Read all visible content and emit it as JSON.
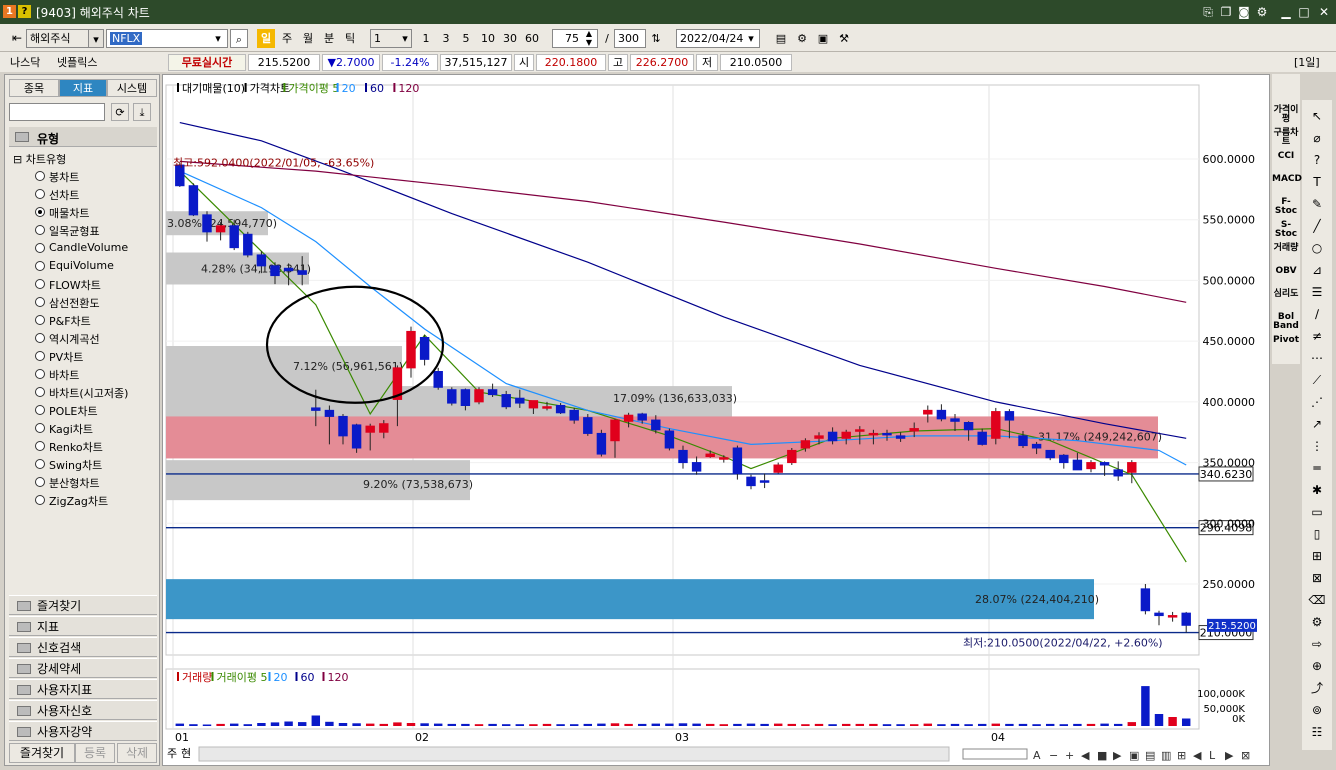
{
  "window": {
    "title": "[9403] 해외주식 차트",
    "badge1": "1",
    "badge2": "?"
  },
  "toolbar": {
    "market": "해외주식",
    "ticker": "NFLX",
    "period_buttons": [
      "일",
      "주",
      "월",
      "분",
      "틱"
    ],
    "interval_value": "1",
    "interval_buttons": [
      "1",
      "3",
      "5",
      "10",
      "30",
      "60"
    ],
    "count_display": "75",
    "count_sep": "/",
    "count_total": "300",
    "date": "2022/04/24"
  },
  "info": {
    "exchange": "나스닥",
    "name": "넷플릭스",
    "realtime_label": "무료실시간",
    "price": "215.5200",
    "change": "▼2.7000",
    "change_pct": "-1.24%",
    "volume": "37,515,127",
    "open_label": "시",
    "open": "220.1800",
    "high_label": "고",
    "high": "226.2700",
    "low_label": "저",
    "low": "210.0500",
    "period_tag": "[1일]"
  },
  "leftpanel": {
    "tabs": [
      "종목",
      "지표",
      "시스템"
    ],
    "active_tab": "지표",
    "section_title": "유형",
    "tree_root": "차트유형",
    "chart_types": [
      "봉차트",
      "선차트",
      "매물차트",
      "일목균형표",
      "CandleVolume",
      "EquiVolume",
      "FLOW차트",
      "삼선전환도",
      "P&F차트",
      "역시계곡선",
      "PV차트",
      "바차트",
      "바차트(시고저종)",
      "POLE차트",
      "Kagi차트",
      "Renko차트",
      "Swing차트",
      "분산형차트",
      "ZigZag차트"
    ],
    "selected_type": "매물차트",
    "folders": [
      "즐겨찾기",
      "지표",
      "신호검색",
      "강세약세",
      "사용자지표",
      "사용자신호",
      "사용자강약"
    ],
    "bottom_buttons": [
      "즐겨찾기",
      "등록",
      "삭제"
    ]
  },
  "chart": {
    "legend": [
      "대기매물(10)",
      "가격차트",
      "가격이평 5",
      "20",
      "60",
      "120"
    ],
    "legend_colors": [
      "#000000",
      "#000000",
      "#3a8a00",
      "#1e90ff",
      "#00008b",
      "#800040"
    ],
    "y_ticks": [
      "600.0000",
      "550.0000",
      "500.0000",
      "450.0000",
      "400.0000",
      "350.0000",
      "300.0000",
      "250.0000"
    ],
    "x_labels": [
      "01",
      "02",
      "03",
      "04"
    ],
    "high_annotation": "최고:592.0400(2022/01/05, -63.65%)",
    "low_annotation": "최저:210.0500(2022/04/22, +2.60%)",
    "price_lines": [
      "340.6230",
      "296.4098",
      "210.0000"
    ],
    "current_tag": "215.5200",
    "volume_profile": [
      {
        "label": "3.08% (24,594,770)"
      },
      {
        "label": "4.28% (34,193,341)"
      },
      {
        "label": "7.12% (56,961,561)"
      },
      {
        "label": "17.09% (136,633,033)"
      },
      {
        "label": "31.17% (249,242,607)"
      },
      {
        "label": "9.20% (73,538,673)"
      },
      {
        "label": "28.07% (224,404,210)"
      }
    ],
    "volume_legend": [
      "거래량",
      "거래이평 5",
      "20",
      "60",
      "120"
    ],
    "volume_ticks": [
      "100,000K",
      "50,000K",
      "0K"
    ],
    "bottom_left_tabs": [
      "주",
      "현"
    ],
    "colors": {
      "up": "#e0001c",
      "down": "#0a1ac8",
      "profile_gray": "#c8c8c8",
      "profile_red": "#e48c96",
      "profile_blue": "#3c96c8"
    }
  },
  "right_indicators": [
    "가격이평",
    "구름차트",
    "CCI",
    "MACD",
    "F-Stoc",
    "S-Stoc",
    "거래량",
    "OBV",
    "심리도",
    "Bol Band",
    "Pivot"
  ],
  "chart_data": {
    "type": "candlestick",
    "ylim": [
      200,
      640
    ],
    "candles": [
      [
        595,
        597,
        577,
        578
      ],
      [
        578,
        580,
        553,
        554
      ],
      [
        554,
        557,
        532,
        540
      ],
      [
        540,
        548,
        533,
        545
      ],
      [
        545,
        550,
        525,
        527
      ],
      [
        538,
        540,
        519,
        521
      ],
      [
        521,
        524,
        506,
        512
      ],
      [
        512,
        515,
        497,
        504
      ],
      [
        510,
        514,
        496,
        508
      ],
      [
        508,
        520,
        496,
        505
      ],
      [
        395,
        410,
        380,
        393
      ],
      [
        393,
        397,
        365,
        388
      ],
      [
        388,
        390,
        365,
        372
      ],
      [
        381,
        382,
        358,
        362
      ],
      [
        375,
        382,
        360,
        380
      ],
      [
        375,
        385,
        370,
        382
      ],
      [
        402,
        430,
        380,
        428
      ],
      [
        428,
        462,
        420,
        458
      ],
      [
        453,
        455,
        430,
        435
      ],
      [
        425,
        428,
        410,
        412
      ],
      [
        410,
        412,
        397,
        399
      ],
      [
        410,
        411,
        393,
        397
      ],
      [
        400,
        412,
        398,
        410
      ],
      [
        410,
        415,
        404,
        406
      ],
      [
        406,
        409,
        394,
        396
      ],
      [
        403,
        410,
        395,
        399
      ],
      [
        395,
        400,
        390,
        401
      ],
      [
        395,
        400,
        393,
        396
      ],
      [
        397,
        399,
        390,
        391
      ],
      [
        393,
        395,
        382,
        385
      ],
      [
        387,
        390,
        372,
        374
      ],
      [
        374,
        377,
        355,
        357
      ],
      [
        368,
        386,
        354,
        385
      ],
      [
        384,
        391,
        379,
        389
      ],
      [
        390,
        391,
        382,
        385
      ],
      [
        385,
        389,
        374,
        377
      ],
      [
        376,
        378,
        360,
        362
      ],
      [
        360,
        364,
        345,
        350
      ],
      [
        350,
        355,
        340,
        343
      ],
      [
        355,
        360,
        354,
        357
      ],
      [
        354,
        356,
        350,
        354
      ],
      [
        362,
        364,
        336,
        341
      ],
      [
        338,
        340,
        328,
        331
      ],
      [
        335,
        341,
        329,
        334
      ],
      [
        342,
        350,
        341,
        348
      ],
      [
        350,
        362,
        348,
        360
      ],
      [
        362,
        370,
        359,
        368
      ],
      [
        370,
        375,
        365,
        372
      ],
      [
        375,
        379,
        365,
        368
      ],
      [
        370,
        377,
        365,
        375
      ],
      [
        377,
        380,
        365,
        377
      ],
      [
        374,
        377,
        365,
        374
      ],
      [
        374,
        377,
        368,
        373
      ],
      [
        372,
        375,
        367,
        370
      ],
      [
        376,
        383,
        371,
        378
      ],
      [
        390,
        397,
        383,
        393
      ],
      [
        393,
        398,
        384,
        386
      ],
      [
        386,
        390,
        376,
        384
      ],
      [
        383,
        384,
        368,
        377
      ],
      [
        375,
        378,
        364,
        365
      ],
      [
        370,
        395,
        365,
        392
      ],
      [
        392,
        394,
        370,
        385
      ],
      [
        372,
        376,
        362,
        364
      ],
      [
        365,
        367,
        357,
        362
      ],
      [
        360,
        360,
        352,
        354
      ],
      [
        356,
        357,
        345,
        350
      ],
      [
        352,
        358,
        344,
        344
      ],
      [
        345,
        352,
        342,
        350
      ],
      [
        350,
        351,
        339,
        348
      ],
      [
        344,
        351,
        335,
        339
      ],
      [
        342,
        352,
        333,
        350
      ],
      [
        246,
        250,
        225,
        228
      ],
      [
        226,
        228,
        216,
        224
      ],
      [
        224,
        227,
        219,
        224
      ],
      [
        226,
        227,
        210,
        216
      ]
    ],
    "volume_k": [
      8,
      6,
      5,
      7,
      8,
      6,
      10,
      12,
      15,
      13,
      35,
      14,
      10,
      9,
      8,
      7,
      12,
      10,
      9,
      8,
      7,
      7,
      6,
      7,
      6,
      6,
      6,
      7,
      6,
      6,
      7,
      8,
      9,
      7,
      7,
      8,
      8,
      9,
      8,
      7,
      6,
      7,
      8,
      7,
      8,
      7,
      6,
      7,
      6,
      7,
      7,
      7,
      6,
      6,
      6,
      8,
      6,
      7,
      6,
      7,
      8,
      7,
      7,
      6,
      7,
      6,
      7,
      7,
      8,
      7,
      13,
      133,
      40,
      30,
      25
    ],
    "ma": {
      "5": [
        [
          0,
          590
        ],
        [
          10,
          480
        ],
        [
          14,
          390
        ],
        [
          18,
          455
        ],
        [
          22,
          408
        ],
        [
          30,
          393
        ],
        [
          36,
          372
        ],
        [
          40,
          355
        ],
        [
          42,
          345
        ],
        [
          48,
          370
        ],
        [
          54,
          376
        ],
        [
          60,
          378
        ],
        [
          64,
          368
        ],
        [
          70,
          340
        ],
        [
          74,
          268
        ]
      ],
      "20": [
        [
          0,
          590
        ],
        [
          6,
          560
        ],
        [
          10,
          532
        ],
        [
          14,
          495
        ],
        [
          18,
          460
        ],
        [
          24,
          415
        ],
        [
          30,
          393
        ],
        [
          36,
          378
        ],
        [
          42,
          365
        ],
        [
          48,
          368
        ],
        [
          54,
          372
        ],
        [
          60,
          372
        ],
        [
          66,
          368
        ],
        [
          72,
          360
        ],
        [
          74,
          348
        ]
      ],
      "60": [
        [
          0,
          630
        ],
        [
          6,
          615
        ],
        [
          12,
          590
        ],
        [
          20,
          555
        ],
        [
          30,
          515
        ],
        [
          40,
          470
        ],
        [
          50,
          430
        ],
        [
          60,
          400
        ],
        [
          68,
          382
        ],
        [
          74,
          370
        ]
      ],
      "120": [
        [
          0,
          598
        ],
        [
          10,
          590
        ],
        [
          20,
          578
        ],
        [
          30,
          565
        ],
        [
          40,
          548
        ],
        [
          50,
          530
        ],
        [
          60,
          510
        ],
        [
          68,
          495
        ],
        [
          74,
          482
        ]
      ]
    }
  }
}
